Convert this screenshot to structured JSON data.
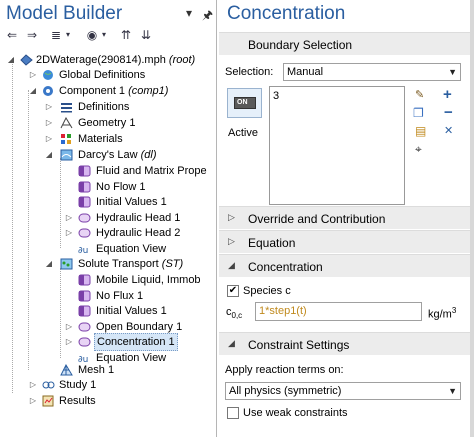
{
  "left": {
    "title": "Model Builder",
    "tree": {
      "root": {
        "label": "2DWaterage(290814).mph",
        "tag": "(root)"
      },
      "global": "Global Definitions",
      "component": {
        "label": "Component 1",
        "tag": "(comp1)"
      },
      "definitions": "Definitions",
      "geometry": "Geometry 1",
      "materials": "Materials",
      "darcy": {
        "label": "Darcy's Law",
        "tag": "(dl)"
      },
      "darcy_items": [
        "Fluid and Matrix Prope",
        "No Flow 1",
        "Initial Values 1",
        "Hydraulic Head 1",
        "Hydraulic Head 2",
        "Equation View"
      ],
      "solute": {
        "label": "Solute Transport",
        "tag": "(ST)"
      },
      "solute_items": [
        "Mobile Liquid, Immob",
        "No Flux 1",
        "Initial Values 1",
        "Open Boundary 1",
        "Concentration 1",
        "Equation View"
      ],
      "mesh": "Mesh 1",
      "study": "Study 1",
      "results": "Results"
    }
  },
  "right": {
    "title": "Concentration",
    "boundary_selection": "Boundary Selection",
    "selection_label": "Selection:",
    "selection_value": "Manual",
    "selection_list": [
      "3"
    ],
    "active_label": "Active",
    "active_badge": "ON",
    "override": "Override and Contribution",
    "equation": "Equation",
    "concentration": "Concentration",
    "species_label": "Species c",
    "c0_label": "c",
    "c0_sub": "0,c",
    "c0_value": "1*step1(t)",
    "unit": "kg/m",
    "unit_sup": "3",
    "constraint": "Constraint Settings",
    "apply_label": "Apply reaction terms on:",
    "apply_value": "All physics (symmetric)",
    "weak_label": "Use weak constraints"
  },
  "colors": {
    "title": "#2a5ea0",
    "section_bg": "#ececec",
    "selected": "#d5e6f7",
    "expression": "#c08a1e"
  }
}
